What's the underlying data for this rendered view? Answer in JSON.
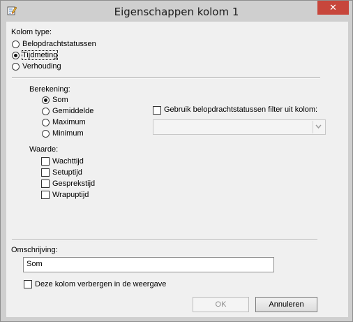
{
  "window": {
    "title": "Eigenschappen kolom 1",
    "close_glyph": "✕",
    "icon": "properties-edit-icon"
  },
  "column_type": {
    "label": "Kolom type:",
    "options": [
      "Belopdrachtstatussen",
      "Tijdmeting",
      "Verhouding"
    ],
    "selected": "Tijdmeting"
  },
  "calculation": {
    "label": "Berekening:",
    "options": [
      "Som",
      "Gemiddelde",
      "Maximum",
      "Minimum"
    ],
    "selected": "Som"
  },
  "filter": {
    "checkbox_label": "Gebruik belopdrachtstatussen filter uit kolom:",
    "checked": false,
    "select_value": ""
  },
  "value": {
    "label": "Waarde:",
    "options": [
      "Wachttijd",
      "Setuptijd",
      "Gesprekstijd",
      "Wrapuptijd"
    ]
  },
  "description": {
    "label": "Omschrijving:",
    "value": "Som"
  },
  "hide_column": {
    "label": "Deze kolom verbergen in de weergave",
    "checked": false
  },
  "buttons": {
    "ok": "OK",
    "cancel": "Annuleren"
  }
}
